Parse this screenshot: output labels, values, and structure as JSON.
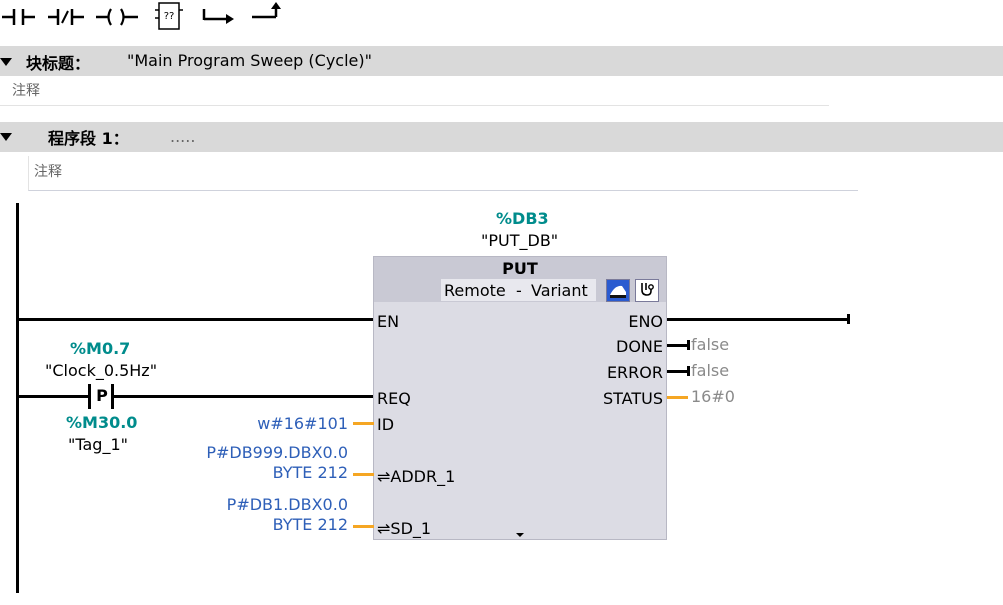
{
  "toolbar": {
    "buttons": [
      {
        "icon": "no-contact-icon"
      },
      {
        "icon": "nc-contact-icon"
      },
      {
        "icon": "coil-icon"
      },
      {
        "icon": "empty-box-icon",
        "text": "??"
      },
      {
        "icon": "open-branch-icon"
      },
      {
        "icon": "close-branch-icon"
      }
    ]
  },
  "block": {
    "label": "块标题：",
    "title": "\"Main Program Sweep (Cycle)\"",
    "comment": "注释"
  },
  "network": {
    "label": "程序段 1：",
    "title": ".....",
    "comment": "注释"
  },
  "fb": {
    "instance_address": "%DB3",
    "instance_name": "\"PUT_DB\"",
    "name": "PUT",
    "sub_a": "Remote",
    "sub_sep": "-",
    "sub_b": "Variant",
    "inputs": {
      "en": "EN",
      "req": "REQ",
      "id": "ID",
      "addr1": "⇌ADDR_1",
      "sd1": "⇌SD_1"
    },
    "outputs": {
      "eno": "ENO",
      "done": "DONE",
      "error": "ERROR",
      "status": "STATUS"
    }
  },
  "contact": {
    "address": "%M0.7",
    "tag": "\"Clock_0.5Hz\"",
    "symbol": "P",
    "edge_address": "%M30.0",
    "edge_tag": "\"Tag_1\""
  },
  "params": {
    "id_value": "w#16#101",
    "addr1_line1": "P#DB999.DBX0.0",
    "addr1_line2": "BYTE 212",
    "sd1_line1": "P#DB1.DBX0.0",
    "sd1_line2": "BYTE 212",
    "done_value": "false",
    "error_value": "false",
    "status_value": "16#0"
  },
  "colors": {
    "teal": "#008c8c",
    "blue": "#2e5fb8",
    "orange": "#f5a623",
    "header_bar": "#d9d9d9"
  }
}
